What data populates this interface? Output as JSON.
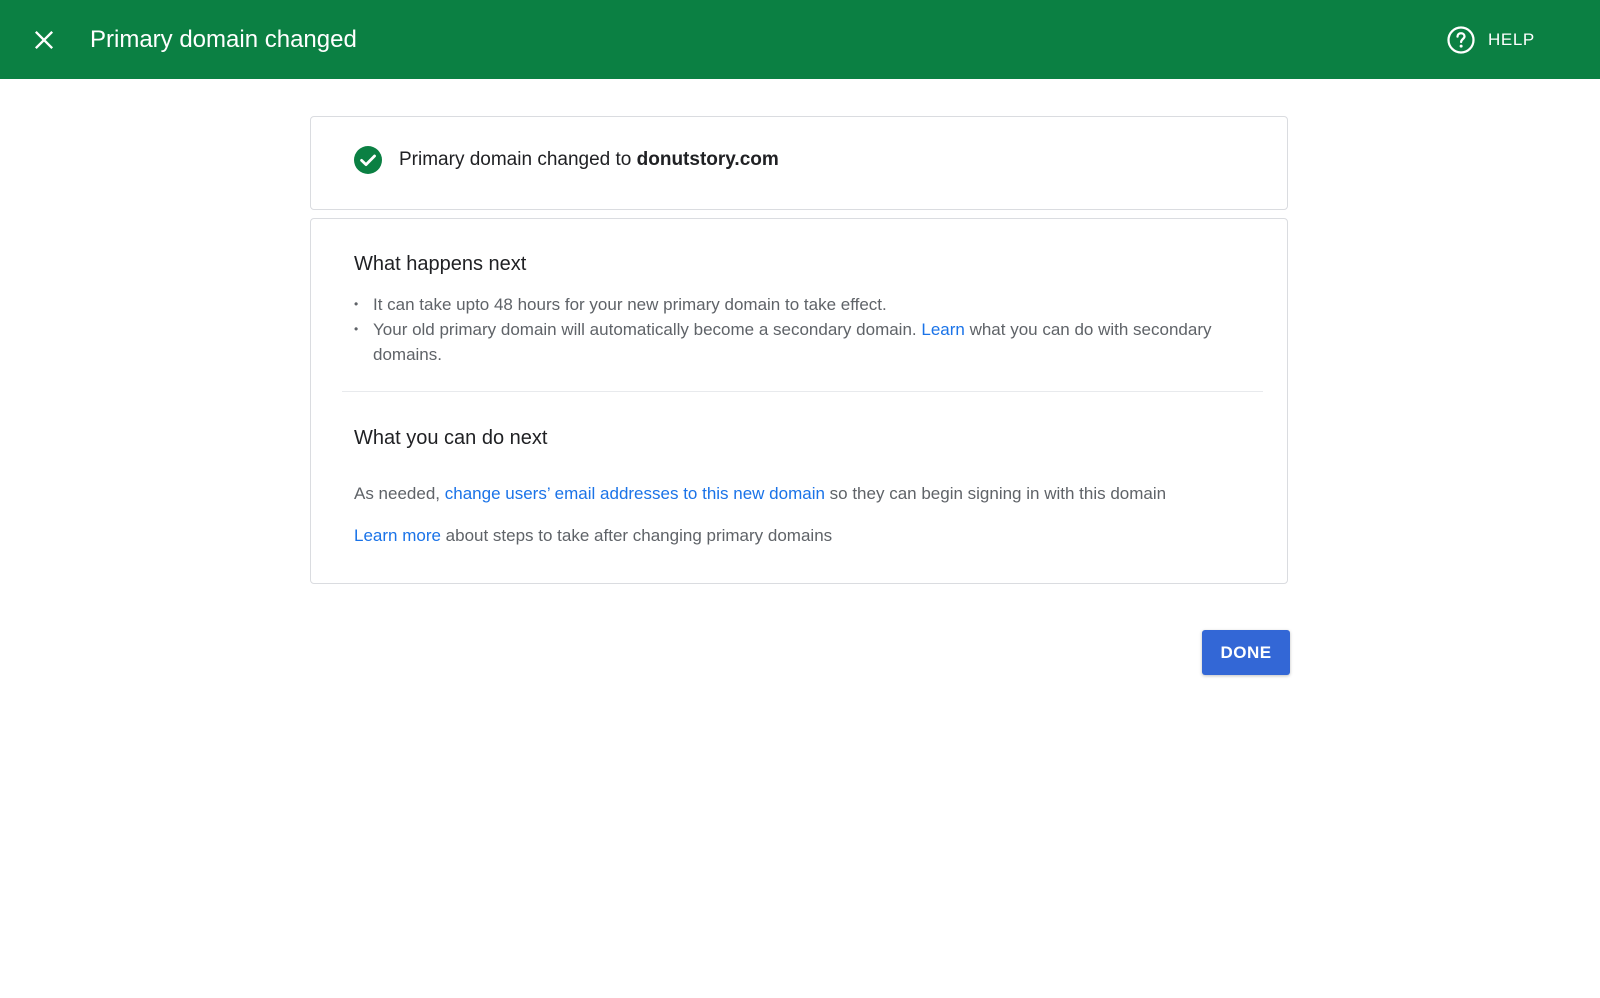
{
  "header": {
    "title": "Primary domain changed",
    "help_label": "HELP",
    "background_color": "#0b8043",
    "icons": {
      "close": "close-icon",
      "help": "help-circle-icon"
    }
  },
  "status_card": {
    "icon": "check-circle-icon",
    "icon_color": "#0b8043",
    "text_prefix": "Primary domain changed to ",
    "domain": "donutstory.com"
  },
  "what_happens_next": {
    "heading": "What happens next",
    "bullets": [
      {
        "text": "It can take upto 48 hours for your new primary domain to take effect."
      },
      {
        "text_before": "Your old primary domain will automatically become a secondary domain. ",
        "link": "Learn",
        "text_after": " what you can do with secondary domains."
      }
    ]
  },
  "what_you_can_do_next": {
    "heading": "What you can do next",
    "paragraph1": {
      "text_before": "As needed, ",
      "link": "change users’ email addresses to this new domain",
      "text_after": " so they can begin signing in with this domain"
    },
    "paragraph2": {
      "link": "Learn more",
      "text_after": " about steps to take after changing primary domains"
    }
  },
  "actions": {
    "done_label": "DONE",
    "done_color": "#3367d6"
  },
  "colors": {
    "link": "#1a73e8",
    "body_text": "#5f6368",
    "heading_text": "#202124"
  }
}
